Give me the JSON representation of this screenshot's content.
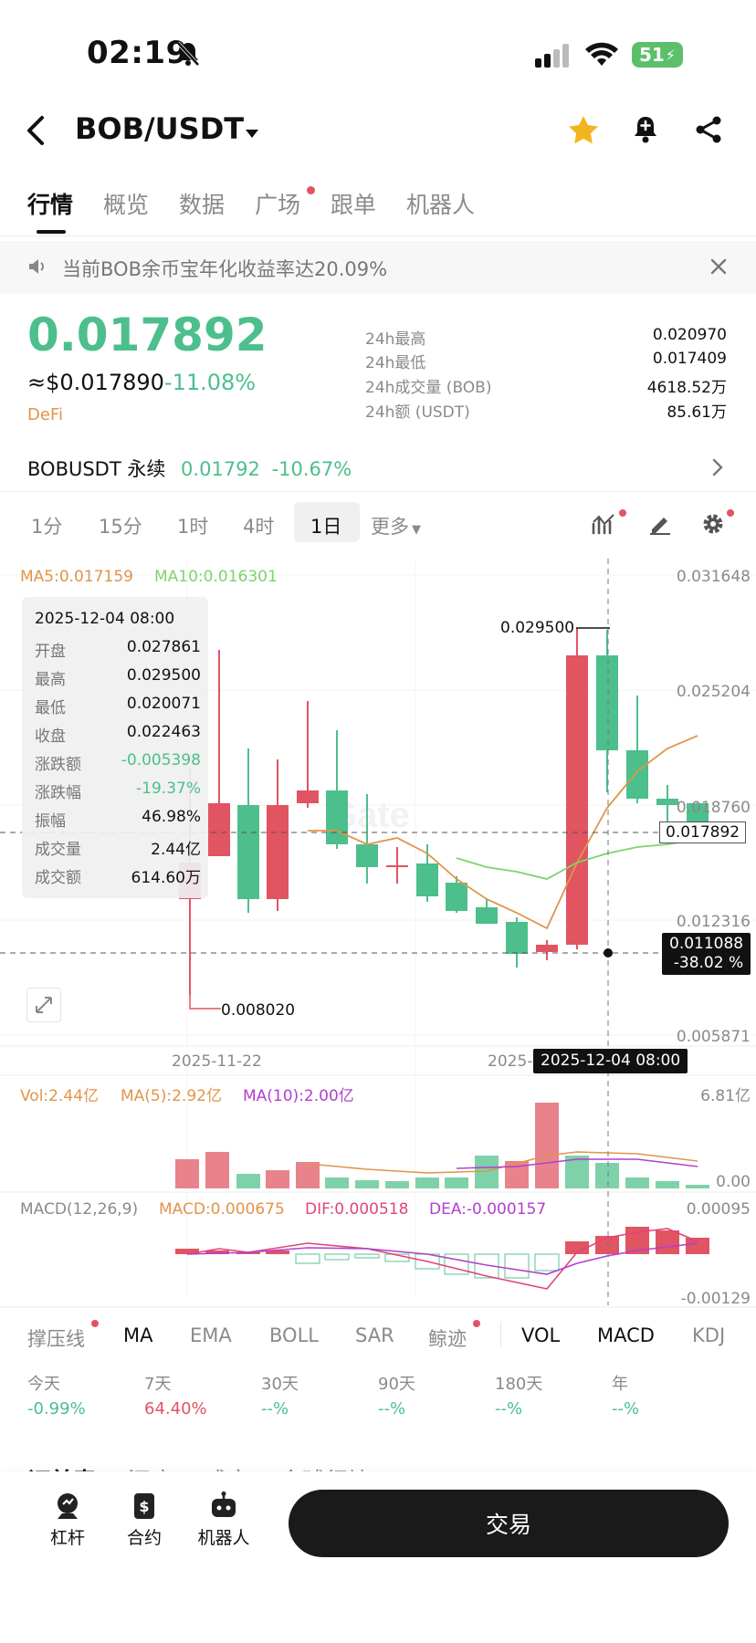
{
  "status": {
    "time": "02:19",
    "battery": "51"
  },
  "header": {
    "pair": "BOB/USDT"
  },
  "tabs": [
    "行情",
    "概览",
    "数据",
    "广场",
    "跟单",
    "机器人"
  ],
  "notice": "当前BOB余币宝年化收益率达20.09%",
  "price": {
    "last": "0.017892",
    "usd": "≈$0.017890",
    "change": "-11.08%",
    "tag": "DeFi"
  },
  "stats": [
    {
      "label": "24h最高",
      "value": "0.020970"
    },
    {
      "label": "24h最低",
      "value": "0.017409"
    },
    {
      "label": "24h成交量 (BOB)",
      "value": "4618.52万"
    },
    {
      "label": "24h额 (USDT)",
      "value": "85.61万"
    }
  ],
  "perp": {
    "name": "BOBUSDT 永续",
    "price": "0.01792",
    "change": "-10.67%"
  },
  "timeframes": [
    "1分",
    "15分",
    "1时",
    "4时",
    "1日",
    "更多"
  ],
  "chart": {
    "ma5": "MA5:0.017159",
    "ma10": "MA10:0.016301",
    "y_ticks": [
      "0.031648",
      "0.025204",
      "0.018760",
      "0.012316",
      "0.005871"
    ],
    "current_price_tag": "0.017892",
    "cross_price": "0.011088",
    "cross_pct": "-38.02 %",
    "high_label": "0.029500",
    "low_label": "0.008020",
    "x_date_left": "2025-11-22",
    "x_date_cut": "2025-",
    "x_cross_date": "2025-12-04 08:00",
    "watermark": "Gate"
  },
  "ohlc": {
    "date": "2025-12-04 08:00",
    "rows": [
      {
        "label": "开盘",
        "value": "0.027861",
        "color": "#111111"
      },
      {
        "label": "最高",
        "value": "0.029500",
        "color": "#111111"
      },
      {
        "label": "最低",
        "value": "0.020071",
        "color": "#111111"
      },
      {
        "label": "收盘",
        "value": "0.022463",
        "color": "#111111"
      },
      {
        "label": "涨跌额",
        "value": "-0.005398",
        "color": "#4cbf8c"
      },
      {
        "label": "涨跌幅",
        "value": "-19.37%",
        "color": "#4cbf8c"
      },
      {
        "label": "振幅",
        "value": "46.98%",
        "color": "#111111"
      },
      {
        "label": "成交量",
        "value": "2.44亿",
        "color": "#111111"
      },
      {
        "label": "成交额",
        "value": "614.60万",
        "color": "#111111"
      }
    ]
  },
  "volume": {
    "vol": "Vol:2.44亿",
    "ma5": "MA(5):2.92亿",
    "ma10": "MA(10):2.00亿",
    "top": "6.81亿",
    "bottom": "0.00"
  },
  "macd": {
    "label": "MACD(12,26,9)",
    "macd": "MACD:0.000675",
    "dif": "DIF:0.000518",
    "dea": "DEA:-0.000157",
    "top": "0.00095",
    "bottom": "-0.00129"
  },
  "indicator_tabs": [
    "撑压线",
    "MA",
    "EMA",
    "BOLL",
    "SAR",
    "鲸迹",
    "VOL",
    "MACD",
    "KDJ"
  ],
  "performance": [
    {
      "label": "今天",
      "value": "-0.99%"
    },
    {
      "label": "7天",
      "value": "64.40%"
    },
    {
      "label": "30天",
      "value": "--%"
    },
    {
      "label": "90天",
      "value": "--%"
    },
    {
      "label": "180天",
      "value": "--%"
    },
    {
      "label": "年",
      "value": "--%"
    }
  ],
  "bottom_tabs_peek": [
    "订单表",
    "深度",
    "成交",
    "全球行情"
  ],
  "bottom_nav": [
    "杠杆",
    "合约",
    "机器人"
  ],
  "trade_button": "交易",
  "colors": {
    "up": "#e15462",
    "down": "#4cbf8c",
    "ma5": "#e0954a",
    "ma10": "#7fd36a",
    "dea": "#b23fcf"
  }
}
